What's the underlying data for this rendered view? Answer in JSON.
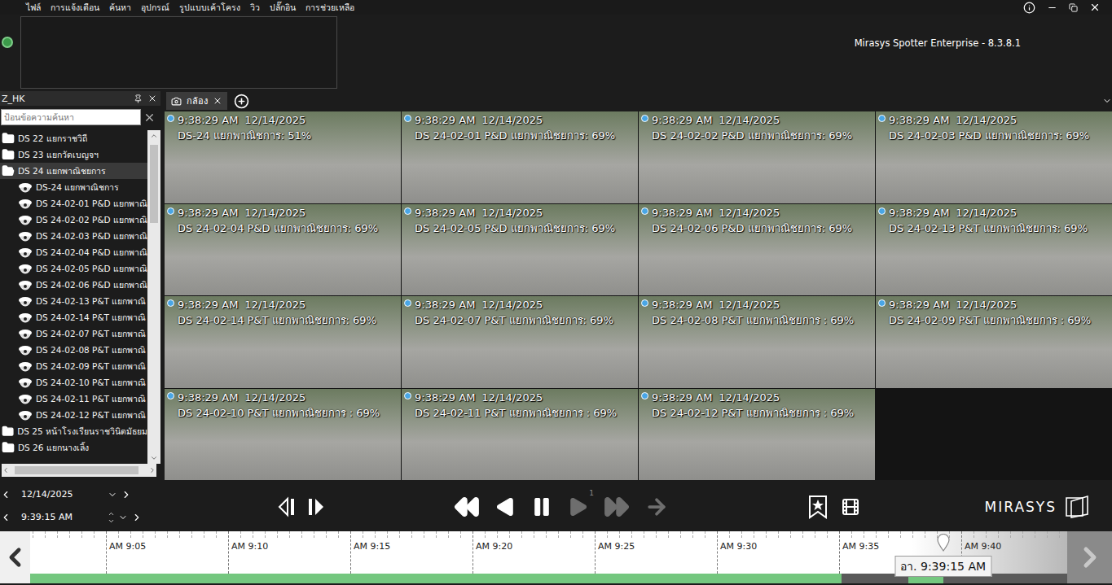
{
  "window": {
    "title": "Mirasys Spotter Enterprise - 8.3.8.1"
  },
  "menu": [
    "ไฟล์",
    "การแจ้งเตือน",
    "ค้นหา",
    "อุปกรณ์",
    "รูปแบบเค้าโครง",
    "วิว",
    "ปลั๊กอิน",
    "การช่วยเหลือ"
  ],
  "panel": {
    "title": "Z_HK",
    "search_placeholder": "ป้อนข้อความค้นหา"
  },
  "tree": [
    {
      "label": "DS 22 แยกราชวิถี",
      "kind": "folder",
      "expanded": false,
      "selected": false
    },
    {
      "label": "DS 23 แยกวัดเบญจฯ",
      "kind": "folder",
      "expanded": false,
      "selected": false
    },
    {
      "label": "DS 24 แยกพาณิชยการ",
      "kind": "folder",
      "expanded": true,
      "selected": true
    },
    {
      "label": "DS-24 แยกพาณิชการ",
      "kind": "camera",
      "expanded": false,
      "selected": false
    },
    {
      "label": "DS 24-02-01 P&D แยกพาณิ",
      "kind": "camera",
      "expanded": false,
      "selected": false
    },
    {
      "label": "DS 24-02-02 P&D แยกพาณิ",
      "kind": "camera",
      "expanded": false,
      "selected": false
    },
    {
      "label": "DS 24-02-03 P&D แยกพาณิ",
      "kind": "camera",
      "expanded": false,
      "selected": false
    },
    {
      "label": "DS 24-02-04 P&D แยกพาณิ",
      "kind": "camera",
      "expanded": false,
      "selected": false
    },
    {
      "label": "DS 24-02-05 P&D แยกพาณิ",
      "kind": "camera",
      "expanded": false,
      "selected": false
    },
    {
      "label": "DS 24-02-06 P&D แยกพาณิ",
      "kind": "camera",
      "expanded": false,
      "selected": false
    },
    {
      "label": "DS 24-02-13 P&T แยกพาณิ",
      "kind": "camera",
      "expanded": false,
      "selected": false
    },
    {
      "label": "DS 24-02-14 P&T แยกพาณิ",
      "kind": "camera",
      "expanded": false,
      "selected": false
    },
    {
      "label": "DS 24-02-07 P&T แยกพาณิ",
      "kind": "camera",
      "expanded": false,
      "selected": false
    },
    {
      "label": "DS 24-02-08 P&T แยกพาณิ",
      "kind": "camera",
      "expanded": false,
      "selected": false
    },
    {
      "label": "DS 24-02-09 P&T แยกพาณิ",
      "kind": "camera",
      "expanded": false,
      "selected": false
    },
    {
      "label": "DS 24-02-10 P&T แยกพาณิ",
      "kind": "camera",
      "expanded": false,
      "selected": false
    },
    {
      "label": "DS 24-02-11 P&T แยกพาณิ",
      "kind": "camera",
      "expanded": false,
      "selected": false
    },
    {
      "label": "DS 24-02-12 P&T แยกพาณิ",
      "kind": "camera",
      "expanded": false,
      "selected": false
    },
    {
      "label": "DS 25 หน้าโรงเรียนราชวินิตมัธยม",
      "kind": "folder",
      "expanded": false,
      "selected": false
    },
    {
      "label": "DS 26 แยกนางเลิ้ง",
      "kind": "folder",
      "expanded": false,
      "selected": false
    }
  ],
  "tabs": [
    {
      "label": "กล้อง",
      "selected": true
    }
  ],
  "cameras": [
    {
      "time": "9:38:29 AM",
      "date": "12/14/2025",
      "name": "DS-24 แยกพาณิชการ: 51%",
      "online": true
    },
    {
      "time": "9:38:29 AM",
      "date": "12/14/2025",
      "name": "DS 24-02-01 P&D แยกพาณิชยการ: 69%",
      "online": true
    },
    {
      "time": "9:38:29 AM",
      "date": "12/14/2025",
      "name": "DS 24-02-02 P&D แยกพาณิชยการ: 69%",
      "online": true
    },
    {
      "time": "9:38:29 AM",
      "date": "12/14/2025",
      "name": "DS 24-02-03 P&D แยกพาณิชยการ: 69%",
      "online": true
    },
    {
      "time": "9:38:29 AM",
      "date": "12/14/2025",
      "name": "DS 24-02-04 P&D แยกพาณิชยการ: 69%",
      "online": true
    },
    {
      "time": "9:38:29 AM",
      "date": "12/14/2025",
      "name": "DS 24-02-05 P&D แยกพาณิชยการ: 69%",
      "online": true
    },
    {
      "time": "9:38:29 AM",
      "date": "12/14/2025",
      "name": "DS 24-02-06 P&D แยกพาณิชยการ: 69%",
      "online": true
    },
    {
      "time": "9:38:29 AM",
      "date": "12/14/2025",
      "name": "DS 24-02-13 P&T แยกพาณิชยการ: 69%",
      "online": true
    },
    {
      "time": "9:38:29 AM",
      "date": "12/14/2025",
      "name": "DS 24-02-14 P&T แยกพาณิชยการ: 69%",
      "online": true
    },
    {
      "time": "9:38:29 AM",
      "date": "12/14/2025",
      "name": "DS 24-02-07 P&T แยกพาณิชยการ: 69%",
      "online": true
    },
    {
      "time": "9:38:29 AM",
      "date": "12/14/2025",
      "name": "DS 24-02-08 P&T แยกพาณิชยการ : 69%",
      "online": true
    },
    {
      "time": "9:38:29 AM",
      "date": "12/14/2025",
      "name": "DS 24-02-09 P&T แยกพาณิชยการ : 69%",
      "online": true
    },
    {
      "time": "9:38:29 AM",
      "date": "12/14/2025",
      "name": "DS 24-02-10 P&T แยกพาณิชยการ : 69%",
      "online": true
    },
    {
      "time": "9:38:29 AM",
      "date": "12/14/2025",
      "name": "DS 24-02-11 P&T แยกพาณิชยการ : 69%",
      "online": true
    },
    {
      "time": "9:38:29 AM",
      "date": "12/14/2025",
      "name": "DS 24-02-12 P&T แยกพาณิชยการ : 69%",
      "online": true
    }
  ],
  "controls": {
    "date": "12/14/2025",
    "time": "9:39:15 AM",
    "speed": "1",
    "frame_buttons": [
      {
        "kind": "step-back",
        "disabled": false
      },
      {
        "kind": "step-forward",
        "disabled": false
      }
    ],
    "playback_buttons": [
      {
        "kind": "rewind",
        "disabled": false
      },
      {
        "kind": "play-reverse",
        "disabled": false
      },
      {
        "kind": "pause",
        "disabled": false
      },
      {
        "kind": "play",
        "disabled": true
      },
      {
        "kind": "fast-forward",
        "disabled": true
      },
      {
        "kind": "next",
        "disabled": true
      }
    ],
    "tool_buttons": [
      {
        "kind": "bookmark",
        "disabled": false
      },
      {
        "kind": "clip",
        "disabled": false
      }
    ]
  },
  "logo": "MIRASYS",
  "timeline": {
    "start_min": 1.9,
    "end_min": 44.33,
    "minor_step_min": 0.5,
    "labels": [
      {
        "text": "AM 9:05",
        "minute": 5
      },
      {
        "text": "AM 9:10",
        "minute": 10
      },
      {
        "text": "AM 9:15",
        "minute": 15
      },
      {
        "text": "AM 9:20",
        "minute": 20
      },
      {
        "text": "AM 9:25",
        "minute": 25
      },
      {
        "text": "AM 9:30",
        "minute": 30
      },
      {
        "text": "AM 9:35",
        "minute": 35
      },
      {
        "text": "AM 9:40",
        "minute": 40
      }
    ],
    "cursor_min": 39.25,
    "cursor_label": "อา. 9:39:15 AM",
    "segments": [
      {
        "start_min": 1.9,
        "end_min": 35.1,
        "recorded": true
      },
      {
        "start_min": 35.1,
        "end_min": 37.83,
        "recorded": false
      },
      {
        "start_min": 37.83,
        "end_min": 39.25,
        "recorded": true
      },
      {
        "start_min": 39.25,
        "end_min": 44.33,
        "recorded": false
      }
    ]
  }
}
